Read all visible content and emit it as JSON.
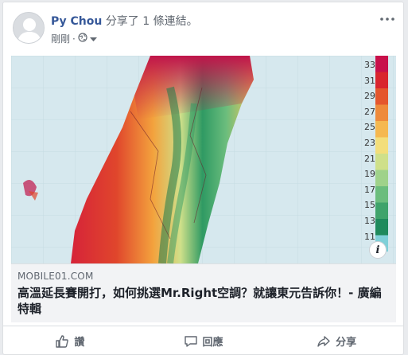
{
  "post": {
    "author": "Py Chou",
    "share_text": "分享了 1 條連結。",
    "time": "剛剛",
    "separator": "·",
    "privacy_icon": "globe-icon",
    "more_icon": "ellipsis-icon"
  },
  "link": {
    "domain": "MOBILE01.COM",
    "headline": "高溫延長賽開打，如何挑選Mr.Right空調？就讓東元告訴你！- 廣編特輯",
    "info_label": "i",
    "legend": {
      "labels": [
        "33",
        "31",
        "29",
        "27",
        "25",
        "23",
        "21",
        "19",
        "17",
        "15",
        "13",
        "11"
      ],
      "colors": [
        "#c8104a",
        "#d9252e",
        "#e4562d",
        "#ee8a3a",
        "#f5b850",
        "#f3de7a",
        "#cfe08a",
        "#9fd28a",
        "#6bbd7d",
        "#3fa36b",
        "#1f8a5c",
        "#7fd0d8"
      ]
    }
  },
  "actions": {
    "like": "讚",
    "comment": "回應",
    "share": "分享"
  }
}
